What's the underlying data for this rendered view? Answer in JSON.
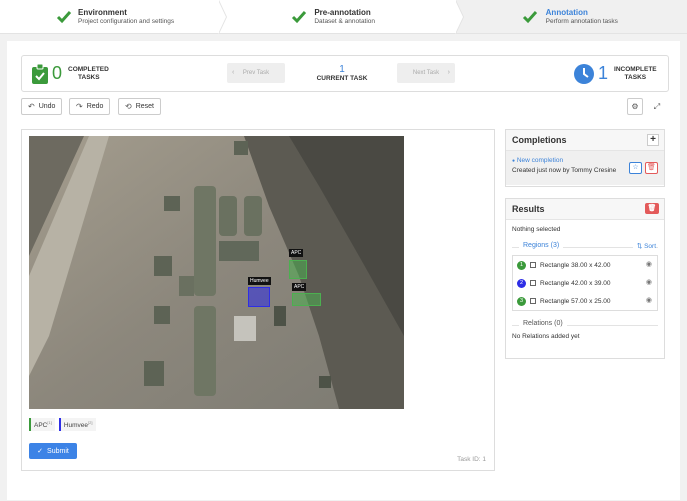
{
  "stepper": [
    {
      "title": "Environment",
      "subtitle": "Project configuration and settings"
    },
    {
      "title": "Pre-annotation",
      "subtitle": "Dataset & annotation"
    },
    {
      "title": "Annotation",
      "subtitle": "Perform annotation tasks"
    }
  ],
  "taskbar": {
    "completed_count": "0",
    "completed_label_1": "COMPLETED",
    "completed_label_2": "TASKS",
    "prev_label": "Prev Task",
    "next_label": "Next Task",
    "current_number": "1",
    "current_label": "CURRENT TASK",
    "incomplete_count": "1",
    "incomplete_label_1": "INCOMPLETE",
    "incomplete_label_2": "TASKS"
  },
  "toolbar": {
    "undo": "Undo",
    "redo": "Redo",
    "reset": "Reset"
  },
  "image": {
    "regions": [
      {
        "label": "APC",
        "color": "#4caf50"
      },
      {
        "label": "Humvee",
        "color": "#2e2ee6"
      },
      {
        "label": "APC",
        "color": "#4caf50"
      }
    ]
  },
  "label_chips": [
    {
      "name": "APC",
      "hotkey": "[1]",
      "color": "#3b9a3b"
    },
    {
      "name": "Humvee",
      "hotkey": "[2]",
      "color": "#2e2ee6"
    }
  ],
  "submit_label": "Submit",
  "task_id": "Task ID: 1",
  "completions": {
    "title": "Completions",
    "item_title": "New completion",
    "item_subtitle": "Created just now by Tommy Cresine"
  },
  "results": {
    "title": "Results",
    "nothing_selected": "Nothing selected",
    "regions_label": "Regions (3)",
    "sort_label": "Sort",
    "regions": [
      {
        "index": "1",
        "text": "Rectangle 38.00 x 42.00",
        "color": "#3b9a3b"
      },
      {
        "index": "2",
        "text": "Rectangle 42.00 x 39.00",
        "color": "#2e2ee6"
      },
      {
        "index": "3",
        "text": "Rectangle 57.00 x 25.00",
        "color": "#3b9a3b"
      }
    ],
    "relations_label": "Relations (0)",
    "no_relations": "No Relations added yet"
  }
}
